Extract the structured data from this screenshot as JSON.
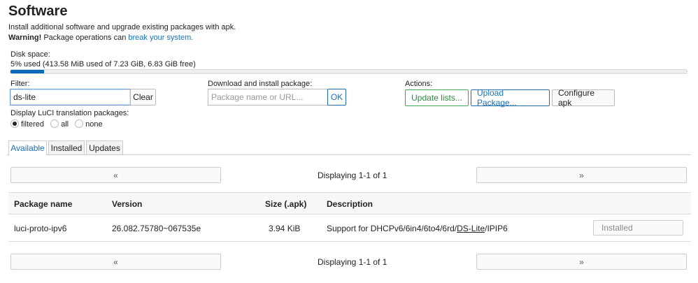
{
  "page": {
    "title": "Software",
    "description": "Install additional software and upgrade existing packages with apk.",
    "warning_label": "Warning!",
    "warning_text": "Package operations can",
    "warning_link": "break your system."
  },
  "disk": {
    "label": "Disk space:",
    "usage_text": "5% used (413.58 MiB used of 7.23 GiB, 6.83 GiB free)",
    "used_fraction": 0.05
  },
  "filter": {
    "label": "Filter:",
    "value": "ds-lite",
    "clear_label": "Clear"
  },
  "download": {
    "label": "Download and install package:",
    "placeholder": "Package name or URL...",
    "ok_label": "OK"
  },
  "actions": {
    "label": "Actions:",
    "update_lists": "Update lists...",
    "upload_package": "Upload Package...",
    "configure_apk": "Configure apk"
  },
  "translation": {
    "label": "Display LuCI translation packages:",
    "options": [
      {
        "label": "filtered",
        "selected": true
      },
      {
        "label": "all",
        "selected": false
      },
      {
        "label": "none",
        "selected": false
      }
    ]
  },
  "tabs": [
    {
      "label": "Available",
      "active": true
    },
    {
      "label": "Installed",
      "active": false
    },
    {
      "label": "Updates",
      "active": false
    }
  ],
  "pager": {
    "prev": "«",
    "next": "»",
    "status": "Displaying 1-1 of 1"
  },
  "table": {
    "headers": [
      "Package name",
      "Version",
      "Size (.apk)",
      "Description"
    ],
    "rows": [
      {
        "name": "luci-proto-ipv6",
        "version": "26.082.75780~067535e",
        "size": "3.94 KiB",
        "description_pre": "Support for DHCPv6/6in4/6to4/6rd/",
        "description_link": "DS-Lite",
        "description_post": "/IPIP6",
        "action": "Installed"
      }
    ]
  }
}
